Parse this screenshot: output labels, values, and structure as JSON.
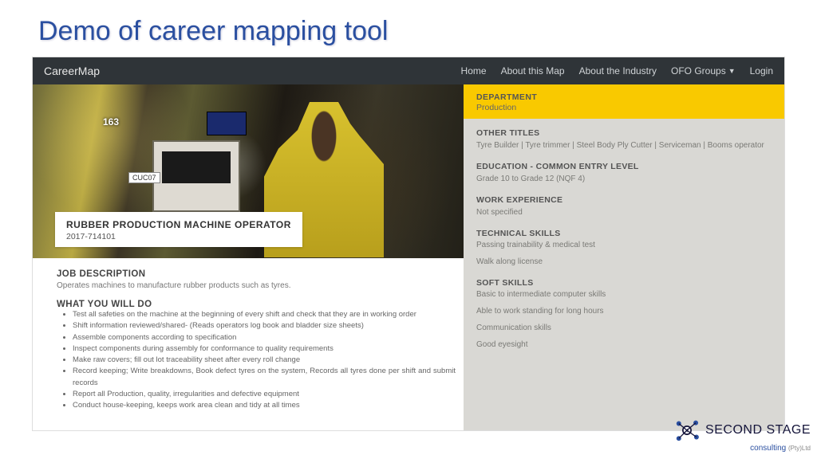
{
  "slide": {
    "title": "Demo of career mapping tool"
  },
  "nav": {
    "brand": "CareerMap",
    "items": [
      "Home",
      "About this Map",
      "About the Industry",
      "OFO Groups",
      "Login"
    ],
    "dropdown_index": 3
  },
  "hero": {
    "marker1": "163",
    "marker2": "CUC07"
  },
  "job": {
    "title": "RUBBER PRODUCTION MACHINE OPERATOR",
    "code": "2017-714101",
    "desc_heading": "JOB DESCRIPTION",
    "desc_text": "Operates machines to manufacture rubber products such as tyres.",
    "duties_heading": "WHAT YOU WILL DO",
    "duties": [
      "Test all safeties on the machine at the beginning of every shift and check that they are in working order",
      "Shift information reviewed/shared- (Reads operators log book and bladder size sheets)",
      "Assemble components according to specification",
      "Inspect components during assembly for conformance to quality requirements",
      "Make raw covers; fill out lot traceability sheet after every roll change",
      "Record keeping; Write breakdowns, Book defect tyres on the system, Records all tyres done per shift and submit records",
      "Report all Production, quality, irregularities and defective equipment",
      "Conduct house-keeping, keeps work area clean and tidy at all times"
    ]
  },
  "sidebar": {
    "department": {
      "label": "DEPARTMENT",
      "value": "Production"
    },
    "other_titles": {
      "label": "OTHER TITLES",
      "value": "Tyre Builder | Tyre trimmer | Steel Body Ply Cutter | Serviceman | Booms operator"
    },
    "education": {
      "label": "EDUCATION - COMMON ENTRY LEVEL",
      "value": "Grade 10 to Grade 12 (NQF 4)"
    },
    "experience": {
      "label": "WORK EXPERIENCE",
      "value": "Not specified"
    },
    "technical": {
      "label": "TECHNICAL SKILLS",
      "lines": [
        "Passing trainability & medical test",
        "Walk along license"
      ]
    },
    "soft": {
      "label": "SOFT SKILLS",
      "lines": [
        "Basic to intermediate computer skills",
        "Able to work standing for long hours",
        "Communication skills",
        "Good eyesight"
      ]
    }
  },
  "footer": {
    "brand": "SECOND STAGE",
    "sub": "consulting",
    "pty": "(Pty)Ltd"
  }
}
